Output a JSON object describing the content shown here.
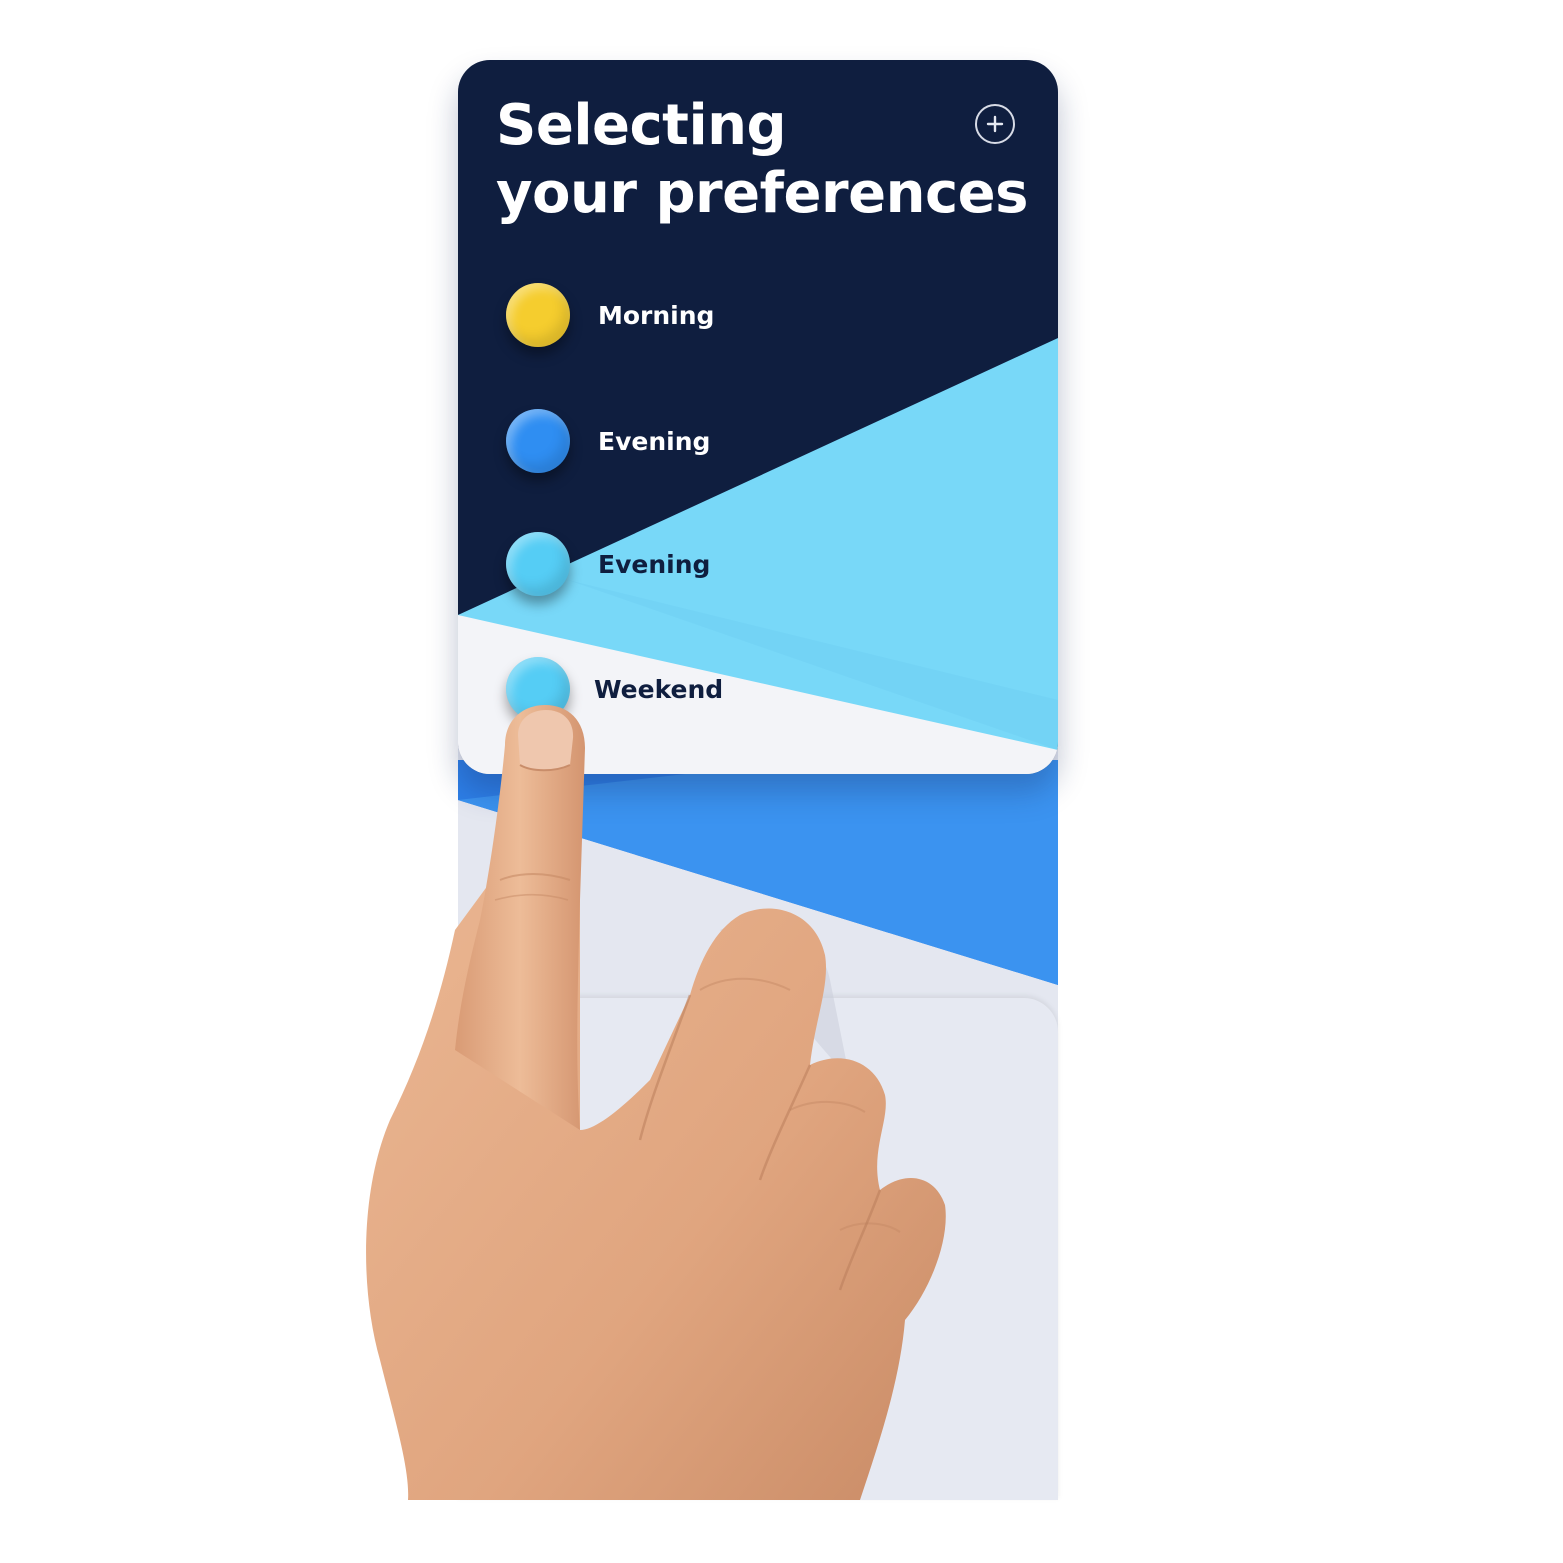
{
  "title": {
    "line1": "Selecting",
    "line2": "your preferences"
  },
  "add_icon": "plus-circle-icon",
  "options": [
    {
      "label": "Morning",
      "dot_color": "#f5cd2e",
      "label_color": "#ffffff"
    },
    {
      "label": "Evening",
      "dot_color": "#2f8ef2",
      "label_color": "#ffffff"
    },
    {
      "label": "Evening",
      "dot_color": "#55cdf5",
      "label_color": "#0f1e3f"
    },
    {
      "label": "Weekend",
      "dot_color": "#55cdf5",
      "label_color": "#0f1e3f"
    }
  ],
  "colors": {
    "navy": "#0f1e3f",
    "light_blue": "#78d8f8",
    "mid_blue": "#3b93f0",
    "white_panel": "#f3f4f8",
    "lower_panel": "#e6e9f2",
    "skin": "#e2ab86"
  }
}
